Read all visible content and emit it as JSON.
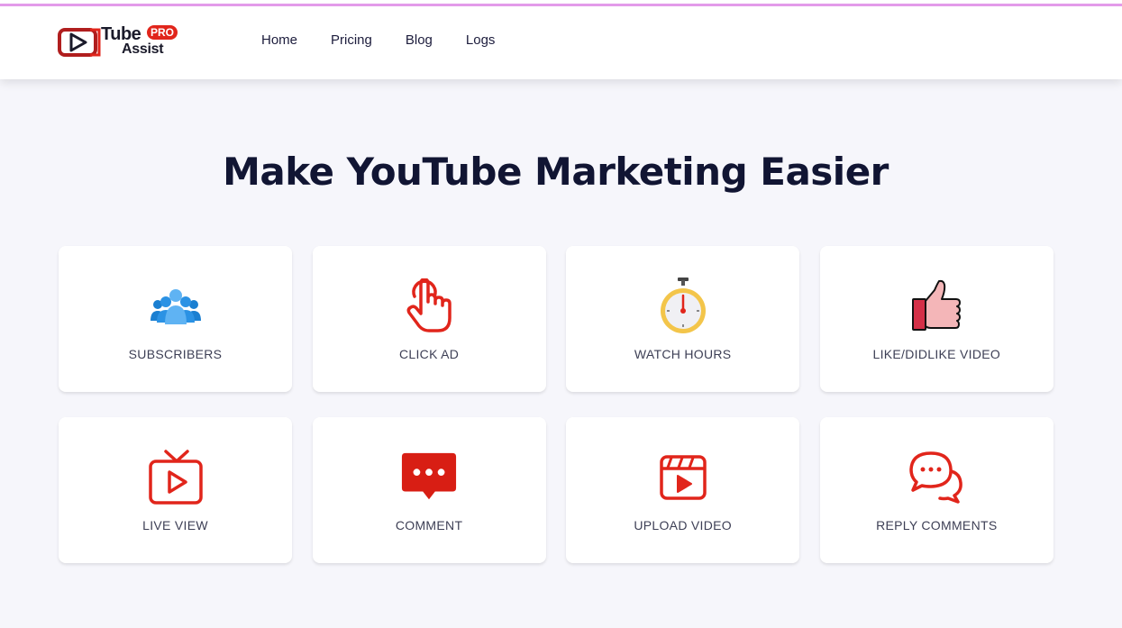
{
  "header": {
    "logo": {
      "line1": "Tube",
      "line2": "Assist",
      "badge": "PRO",
      "colors": {
        "red": "#e1251b",
        "dark": "#1a1a2a"
      }
    },
    "nav": [
      {
        "label": "Home"
      },
      {
        "label": "Pricing"
      },
      {
        "label": "Blog"
      },
      {
        "label": "Logs"
      }
    ],
    "accent_line_color": "#e39be9"
  },
  "hero": {
    "title": "Make YouTube Marketing Easier"
  },
  "features": [
    {
      "label": "SUBSCRIBERS",
      "icon": "people-group-icon"
    },
    {
      "label": "CLICK AD",
      "icon": "tap-hand-icon"
    },
    {
      "label": "WATCH HOURS",
      "icon": "stopwatch-icon"
    },
    {
      "label": "LIKE/DIDLIKE VIDEO",
      "icon": "thumbs-up-icon"
    },
    {
      "label": "LIVE VIEW",
      "icon": "tv-play-icon"
    },
    {
      "label": "COMMENT",
      "icon": "comment-bubble-icon"
    },
    {
      "label": "UPLOAD VIDEO",
      "icon": "video-clapper-icon"
    },
    {
      "label": "REPLY COMMENTS",
      "icon": "reply-bubbles-icon"
    }
  ],
  "colors": {
    "page_background": "#f6f6fb",
    "card_background": "#ffffff",
    "icon_red": "#e1251b",
    "title_navy": "#111533"
  }
}
